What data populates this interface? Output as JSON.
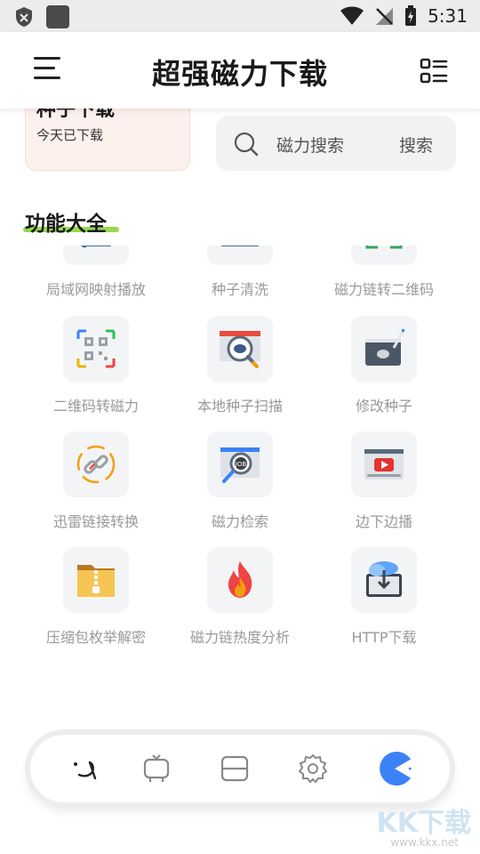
{
  "status_bar": {
    "time": "5:31",
    "icons": [
      "shield-icon",
      "app-square-icon",
      "wifi-icon",
      "no-sim-icon",
      "battery-charging-icon"
    ]
  },
  "header": {
    "title": "超强磁力下载",
    "menu_icon": "menu-icon",
    "grid_icon": "grid-list-icon"
  },
  "download_card": {
    "title": "种子下载",
    "subtitle": "今天已下载"
  },
  "search_card": {
    "placeholder": "磁力搜索",
    "button": "搜索"
  },
  "section": {
    "title": "功能大全",
    "accent": "#8ad63b"
  },
  "features": [
    {
      "label": "局域网映射播放",
      "icon": "lan-player-icon"
    },
    {
      "label": "种子清洗",
      "icon": "torrent-clean-icon"
    },
    {
      "label": "磁力链转二维码",
      "icon": "magnet-to-qr-icon"
    },
    {
      "label": "二维码转磁力",
      "icon": "qr-to-magnet-icon"
    },
    {
      "label": "本地种子扫描",
      "icon": "local-scan-icon"
    },
    {
      "label": "修改种子",
      "icon": "edit-torrent-icon"
    },
    {
      "label": "迅雷链接转换",
      "icon": "link-convert-icon"
    },
    {
      "label": "磁力检索",
      "icon": "magnet-search-icon"
    },
    {
      "label": "边下边播",
      "icon": "stream-play-icon"
    },
    {
      "label": "压缩包枚举解密",
      "icon": "archive-decrypt-icon"
    },
    {
      "label": "磁力链热度分析",
      "icon": "heat-analysis-icon"
    },
    {
      "label": "HTTP下载",
      "icon": "http-download-icon"
    }
  ],
  "bottom_nav": [
    {
      "name": "home-icon"
    },
    {
      "name": "tv-icon"
    },
    {
      "name": "cards-icon"
    },
    {
      "name": "settings-icon"
    },
    {
      "name": "pacman-icon",
      "color": "#3b82f6"
    }
  ],
  "watermark": {
    "logo": "KK下载",
    "url": "www.kkx.net"
  }
}
